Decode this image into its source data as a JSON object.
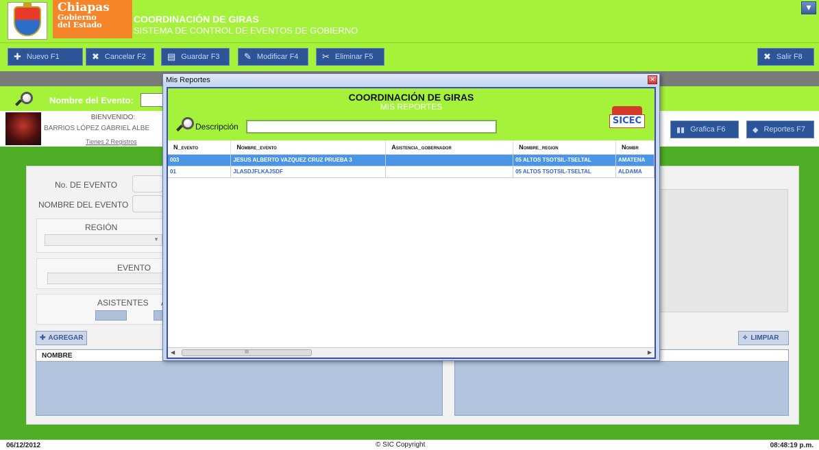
{
  "header": {
    "org_line1": "Chiapas",
    "org_line2": "Gobierno",
    "org_line3": "del Estado",
    "title": "COORDINACIÓN DE GIRAS",
    "subtitle": "SISTEMA DE CONTROL DE EVENTOS DE GOBIERNO",
    "minimize_icon": "minimize-icon"
  },
  "toolbar": {
    "nuevo": "Nuevo F1",
    "cancelar": "Cancelar F2",
    "guardar": "Guardar F3",
    "modificar": "Modificar F4",
    "eliminar": "Eliminar F5",
    "salir": "Salir F8"
  },
  "search": {
    "label": "Nombre del Evento:"
  },
  "user": {
    "welcome": "BIENVENIDO:",
    "name": "BARRIOS LÓPEZ GABRIEL ALBE",
    "records": "Tienes 2 Registros",
    "grafica": "Grafica F6",
    "reportes": "Reportes F7"
  },
  "form": {
    "no_evento": "No. DE EVENTO",
    "nombre_evento": "NOMBRE DEL EVENTO",
    "region": "REGIÓN",
    "evento": "EVENTO",
    "asistentes": "ASISTENTES",
    "asistentes_extra": "A",
    "agregar": "AGREGAR",
    "limpiar": "LIMPIAR",
    "grid_header": "NOMBRE"
  },
  "modal": {
    "window_title": "Mis Reportes",
    "title": "COORDINACIÓN DE GIRAS",
    "subtitle": "MIS REPORTES",
    "logo_text": "SICEC",
    "desc_label": "Descripción",
    "desc_value": "",
    "columns": [
      "N_evento",
      "Nombre_evento",
      "Asistencia_gobernador",
      "Nombre_region",
      "Nombr"
    ],
    "rows": [
      [
        "003",
        "JESUS ALBERTO VAZQUEZ CRUZ PRUEBA 3",
        "",
        "05 ALTOS TSOTSIL-TSELTAL",
        "AMATENA"
      ],
      [
        "01",
        "JLASDJFLKAJSDF",
        "",
        "05 ALTOS TSOTSIL-TSELTAL",
        "ALDAMA"
      ]
    ],
    "selected_row": 0,
    "scroll_thumb": "III"
  },
  "status": {
    "date": "06/12/2012",
    "copyright": "© SIC Copyright",
    "time": "08:48:19 p.m."
  },
  "colors": {
    "header_green": "#a4f23a",
    "main_green": "#4fae25",
    "button_blue": "#2b5597",
    "orange": "#f6852a",
    "selection_blue": "#4a96e6"
  }
}
